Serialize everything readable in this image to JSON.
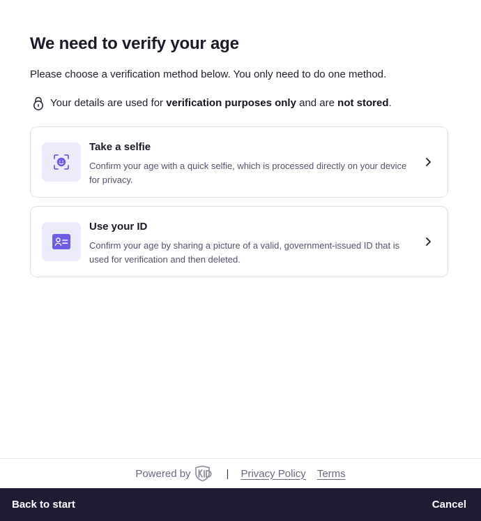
{
  "header": {
    "title": "We need to verify your age",
    "subtitle": "Please choose a verification method below. You only need to do one method."
  },
  "privacy_note": {
    "part1": "Your details are used for ",
    "bold1": "verification purposes only",
    "part2": " and are ",
    "bold2": "not stored",
    "part3": ".",
    "icon": "lock-icon"
  },
  "methods": [
    {
      "title": "Take a selfie",
      "description": "Confirm your age with a quick selfie, which is processed directly on your device for privacy.",
      "icon": "face-scan-icon"
    },
    {
      "title": "Use your ID",
      "description": "Confirm your age by sharing a picture of a valid, government-issued ID that is used for verification and then deleted.",
      "icon": "id-card-icon"
    }
  ],
  "footer": {
    "powered_by": "Powered by",
    "separator": "|",
    "privacy_policy": "Privacy Policy",
    "terms": "Terms"
  },
  "bottom_nav": {
    "back": "Back to start",
    "cancel": "Cancel"
  },
  "colors": {
    "accent": "#6c5ce7",
    "tile_bg": "#ecebfb",
    "bottom_bar": "#1f1c36"
  }
}
